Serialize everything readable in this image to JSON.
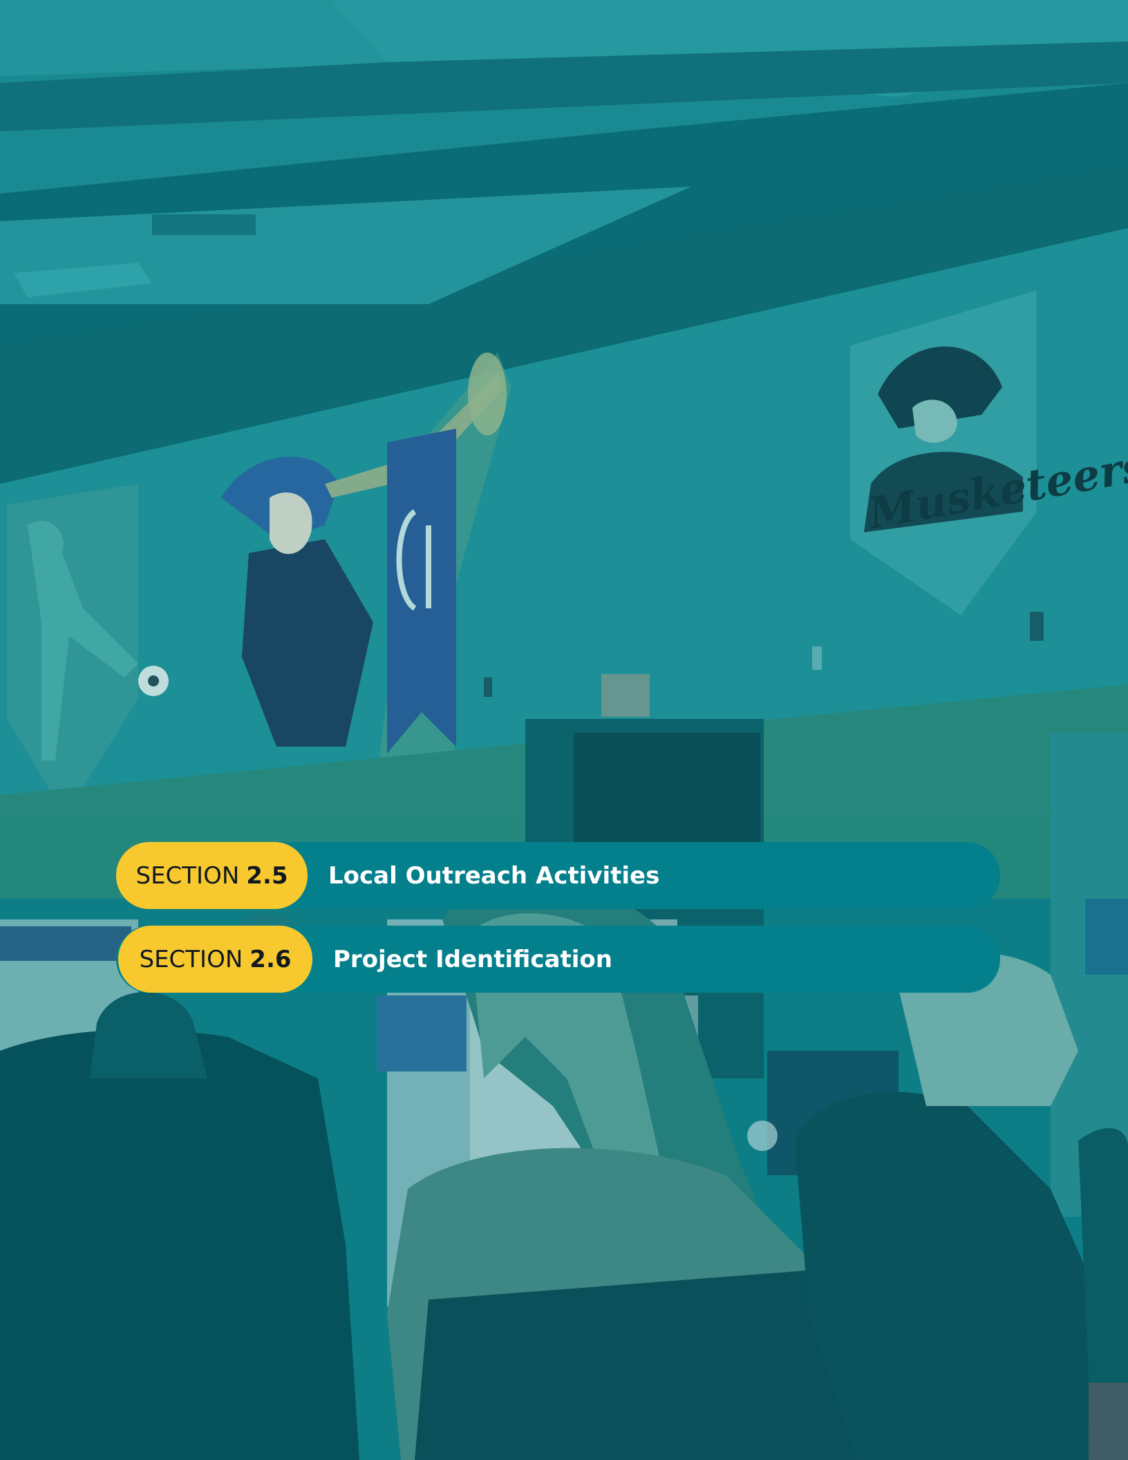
{
  "sections": [
    {
      "label": "SECTION",
      "number": "2.5",
      "title": "Local Outreach Activities"
    },
    {
      "label": "SECTION",
      "number": "2.6",
      "title": "Project Identification"
    }
  ],
  "colors": {
    "overlay_teal": "#04808c",
    "pill_yellow": "#f7c92f",
    "pill_text": "#101820",
    "title_text": "#ffffff"
  }
}
